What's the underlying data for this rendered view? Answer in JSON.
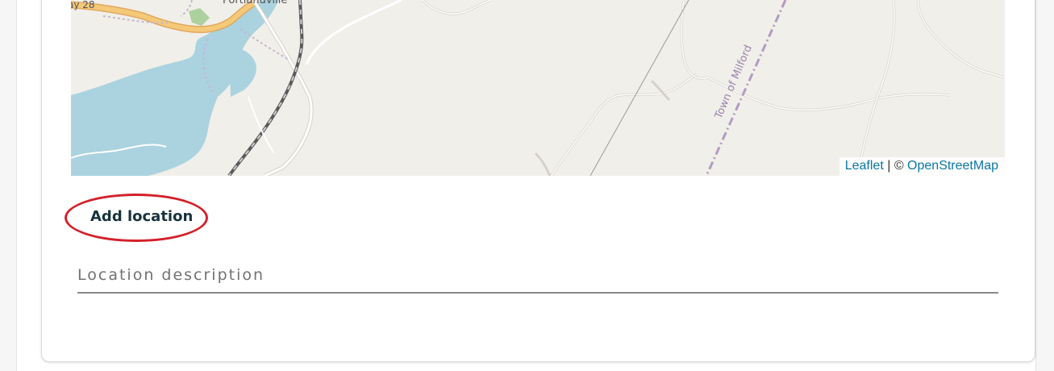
{
  "map": {
    "labels": {
      "highway": "ay 28",
      "town": "Portlandville",
      "town_of": "Town of Milford"
    },
    "attribution": {
      "leaflet": "Leaflet",
      "separator": " | © ",
      "osm": "OpenStreetMap"
    },
    "colors": {
      "land": "#f1efe9",
      "water": "#aad3df",
      "highway": "#f4c978",
      "boundary": "#b39bc4"
    }
  },
  "form": {
    "add_location_label": "Add location",
    "location_description_placeholder": "Location description",
    "location_description_value": ""
  }
}
